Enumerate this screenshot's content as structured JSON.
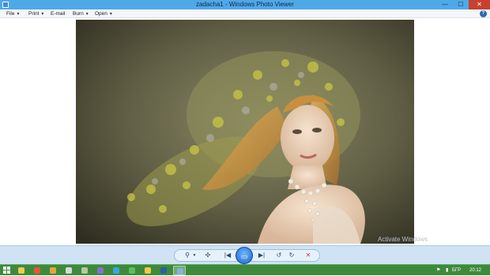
{
  "window": {
    "title": "zadacha1 - Windows Photo Viewer",
    "minimize_label": "—",
    "maximize_label": "☐",
    "close_label": "✕"
  },
  "menu": {
    "items": [
      {
        "label": "File"
      },
      {
        "label": "Print"
      },
      {
        "label": "E-mail"
      },
      {
        "label": "Burn"
      },
      {
        "label": "Open"
      }
    ],
    "help_label": "?"
  },
  "watermark": "Activate Windows",
  "controls": {
    "zoom": "⚲",
    "fit": "✣",
    "previous": "|◀",
    "slideshow": "▭",
    "next": "▶|",
    "rotate_left": "↺",
    "rotate_right": "↻",
    "delete": "✕"
  },
  "taskbar": {
    "apps": [
      {
        "icon": "file-explorer-icon",
        "color": "#f2c94c"
      },
      {
        "icon": "chrome-icon",
        "color": "#e6553a"
      },
      {
        "icon": "media-player-icon",
        "color": "#e8a33a"
      },
      {
        "icon": "printer-icon",
        "color": "#d8d8d8"
      },
      {
        "icon": "notepad-icon",
        "color": "#b6c9a0"
      },
      {
        "icon": "viber-icon",
        "color": "#8a6fd1"
      },
      {
        "icon": "skype-icon",
        "color": "#35a8e0"
      },
      {
        "icon": "green-app-icon",
        "color": "#5bbf5a"
      },
      {
        "icon": "folder-icon",
        "color": "#f2c94c"
      },
      {
        "icon": "photoshop-icon",
        "color": "#2b5fa3"
      },
      {
        "icon": "photo-viewer-icon",
        "color": "#7fb3e0"
      }
    ],
    "language": "БГР",
    "time": "20:12"
  },
  "colors": {
    "titlebar": "#4fa8e8",
    "taskbar": "#3e8a3c",
    "control_bar": "#cfe3f4"
  }
}
